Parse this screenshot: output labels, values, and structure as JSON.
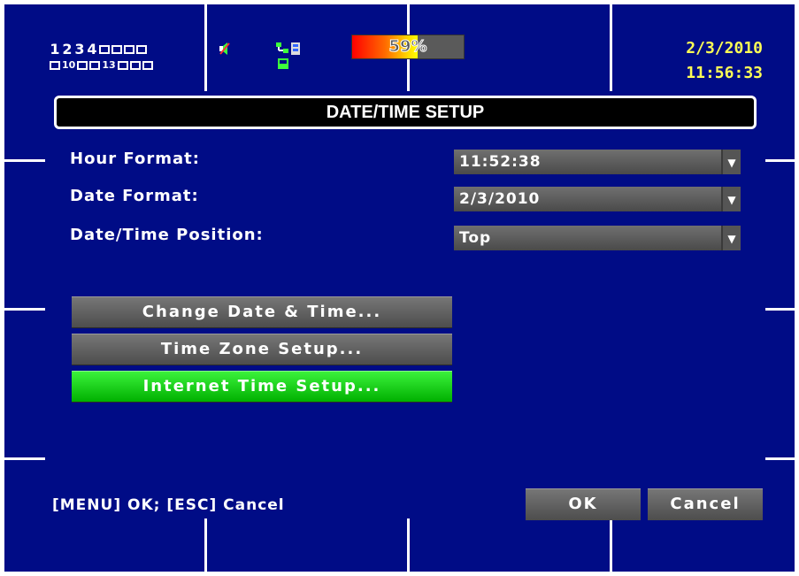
{
  "status": {
    "channels_row1": [
      "1",
      "2",
      "3",
      "4"
    ],
    "channels_row2_labels": [
      "10",
      "13"
    ],
    "hdd_percent": 59,
    "hdd_label": "59%",
    "date": "2/3/2010",
    "time": "11:56:33",
    "icons": [
      "speaker-icon",
      "network-icon",
      "record-icon",
      "disk-icon"
    ]
  },
  "dialog": {
    "title": "DATE/TIME SETUP",
    "fields": [
      {
        "label": "Hour Format:",
        "value": "11:52:38"
      },
      {
        "label": "Date Format:",
        "value": "2/3/2010"
      },
      {
        "label": "Date/Time Position:",
        "value": "Top"
      }
    ],
    "buttons": {
      "change_date_time": "Change Date & Time...",
      "time_zone": "Time Zone Setup...",
      "internet_time": "Internet Time Setup..."
    },
    "hint": "[MENU] OK; [ESC] Cancel",
    "ok": "OK",
    "cancel": "Cancel"
  },
  "colors": {
    "background": "#000c86",
    "highlight": "#00c000",
    "clock": "#ffff55"
  }
}
